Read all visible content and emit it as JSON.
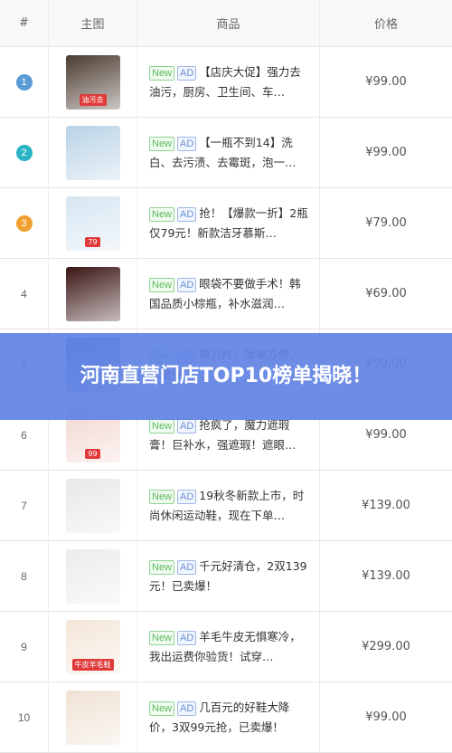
{
  "header": {
    "rank": "#",
    "image": "主图",
    "name": "商品",
    "price": "价格"
  },
  "tags": {
    "new": "New",
    "ad": "AD"
  },
  "rows": [
    {
      "rank": "1",
      "name": "【店庆大促】强力去油污，厨房、卫生间、车…",
      "price": "¥99.00",
      "thumb_color": "#4a3a2e",
      "thumb_tag": "油污去"
    },
    {
      "rank": "2",
      "name": "【一瓶不到14】洗白、去污渍、去霉斑，泡一…",
      "price": "¥99.00",
      "thumb_color": "#b9d3e6",
      "thumb_tag": ""
    },
    {
      "rank": "3",
      "name": "抢！【爆款一折】2瓶仅79元！新款洁牙慕斯…",
      "price": "¥79.00",
      "thumb_color": "#d6e6f2",
      "thumb_tag": "79"
    },
    {
      "rank": "4",
      "name": "眼袋不要做手术！韩国品质小棕瓶，补水滋润…",
      "price": "¥69.00",
      "thumb_color": "#3a1414",
      "thumb_tag": ""
    },
    {
      "rank": "5",
      "name": "换刀片，简单方便，安全省…",
      "price": "¥99.00",
      "thumb_color": "#5a6f9a",
      "thumb_tag": ""
    },
    {
      "rank": "6",
      "name": "抢疯了，魔力遮瑕膏！巨补水，强遮瑕！遮眼…",
      "price": "¥99.00",
      "thumb_color": "#f2d6d0",
      "thumb_tag": "99"
    },
    {
      "rank": "7",
      "name": "19秋冬新款上市，时尚休闲运动鞋，现在下单…",
      "price": "¥139.00",
      "thumb_color": "#e8e8e8",
      "thumb_tag": ""
    },
    {
      "rank": "8",
      "name": "千元好清仓，2双139元！已卖爆！",
      "price": "¥139.00",
      "thumb_color": "#ececec",
      "thumb_tag": ""
    },
    {
      "rank": "9",
      "name": "羊毛牛皮无惧寒冷，我出运费你验货！试穿…",
      "price": "¥299.00",
      "thumb_color": "#f4e6d8",
      "thumb_tag": "牛皮羊毛鞋"
    },
    {
      "rank": "10",
      "name": "几百元的好鞋大降价，3双99元抢，已卖爆！",
      "price": "¥99.00",
      "thumb_color": "#f0e2d4",
      "thumb_tag": ""
    }
  ],
  "overlay": {
    "title": "河南直营门店TOP10榜单揭晓！"
  },
  "colors": {
    "rank1": "#5b9bd5",
    "rank2": "#2bb5c4",
    "rank3": "#f0a030",
    "overlay": "#6082e4"
  }
}
